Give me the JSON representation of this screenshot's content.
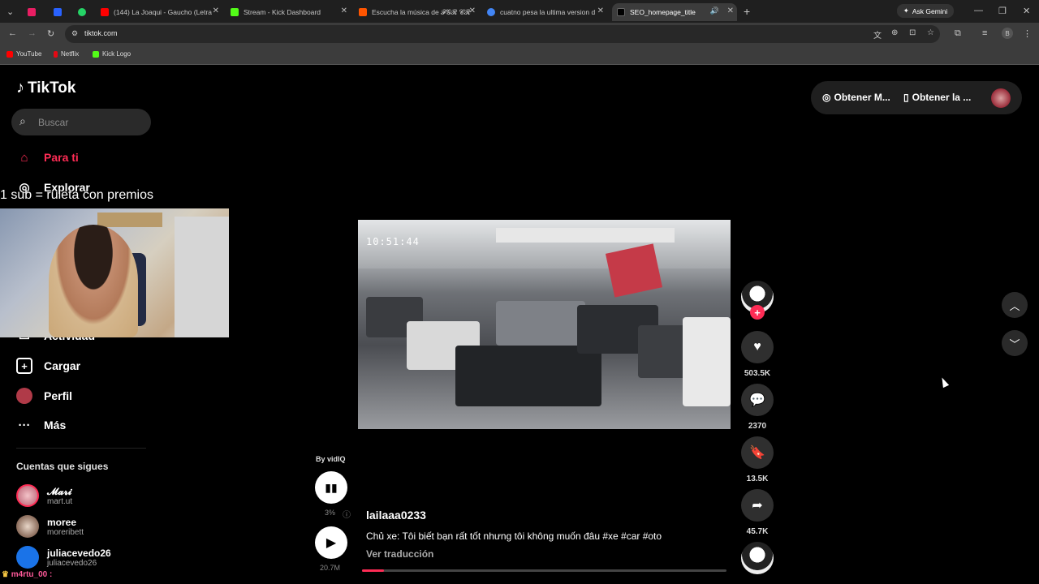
{
  "browser": {
    "tabs": [
      {
        "label": "",
        "color": "#e91e63"
      },
      {
        "label": "",
        "color": "#2962ff"
      },
      {
        "label": "",
        "color": "#25d366"
      },
      {
        "label": "(144) La Joaqui - Gaucho (Letra",
        "color": "#ff0000"
      },
      {
        "label": "Stream - Kick Dashboard",
        "color": "#53fc18"
      },
      {
        "label": "Escucha la música de 𝓕𝓖𝓡 𝓒𝓡",
        "color": "#ff5500"
      },
      {
        "label": "cuatno pesa la ultima version d",
        "color": "#4285f4"
      },
      {
        "label": "SEO_homepage_title",
        "color": "#000000"
      }
    ],
    "ask_gemini": "Ask Gemini",
    "url": "tiktok.com",
    "bookmarks": [
      {
        "label": "YouTube",
        "color": "#ff0000"
      },
      {
        "label": "Netflix",
        "color": "#e50914"
      },
      {
        "label": "Kick Logo",
        "color": "#53fc18"
      }
    ],
    "profile_initial": "B"
  },
  "sidebar": {
    "logo": "TikTok",
    "search_placeholder": "Buscar",
    "nav": [
      {
        "label": "Para ti",
        "icon": "home-icon",
        "active": true
      },
      {
        "label": "Explorar",
        "icon": "compass-icon"
      },
      {
        "label": "Actividad",
        "icon": "activity-icon"
      },
      {
        "label": "Cargar",
        "icon": "upload-icon"
      },
      {
        "label": "Perfil",
        "icon": "profile-icon"
      },
      {
        "label": "Más",
        "icon": "more-icon"
      }
    ],
    "following_title": "Cuentas que sigues",
    "following": [
      {
        "name": "𝓜𝓪𝓻𝓲",
        "handle": "mart.ut"
      },
      {
        "name": "moree",
        "handle": "moreribett"
      },
      {
        "name": "juliacevedo26",
        "handle": "juliacevedo26"
      }
    ]
  },
  "stream_overlay": {
    "text": "1 sub = ruleta con premios",
    "chat_user": "m4rtu_00"
  },
  "top_actions": {
    "coins": "Obtener M...",
    "app": "Obtener la ..."
  },
  "video": {
    "timestamp": "10:51:44",
    "author": "lailaaa0233",
    "caption": "Chủ xe: Tôi biết bạn rất tốt nhưng tôi không muốn đâu #xe #car #oto",
    "translate": "Ver traducción",
    "progress": 0.06,
    "by_vidiq": "By vidIQ",
    "vidiq_percent": "3%",
    "vidiq_views": "20.7M",
    "likes": "503.5K",
    "comments": "2370",
    "saves": "13.5K",
    "shares": "45.7K"
  }
}
